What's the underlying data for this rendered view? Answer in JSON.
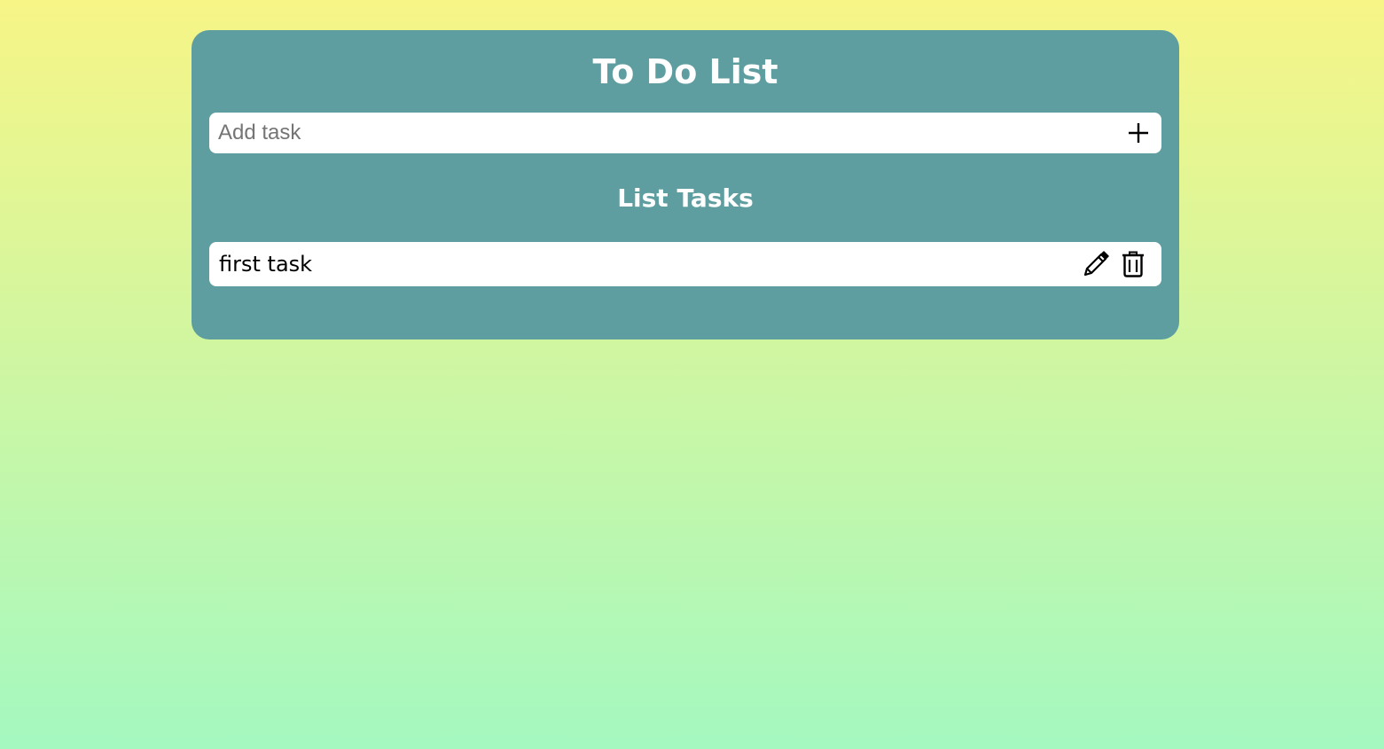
{
  "app": {
    "title": "To Do List"
  },
  "add_task": {
    "placeholder": "Add task",
    "value": "",
    "button_icon": "plus-icon"
  },
  "list": {
    "heading": "List Tasks",
    "tasks": [
      {
        "text": "first task",
        "edit_icon": "pencil-icon",
        "delete_icon": "trash-icon"
      }
    ]
  },
  "colors": {
    "card_background": "#5f9ea0",
    "page_gradient_top": "#f7f586",
    "page_gradient_bottom": "#a4f8c0",
    "text_on_card": "#ffffff",
    "row_background": "#ffffff"
  }
}
